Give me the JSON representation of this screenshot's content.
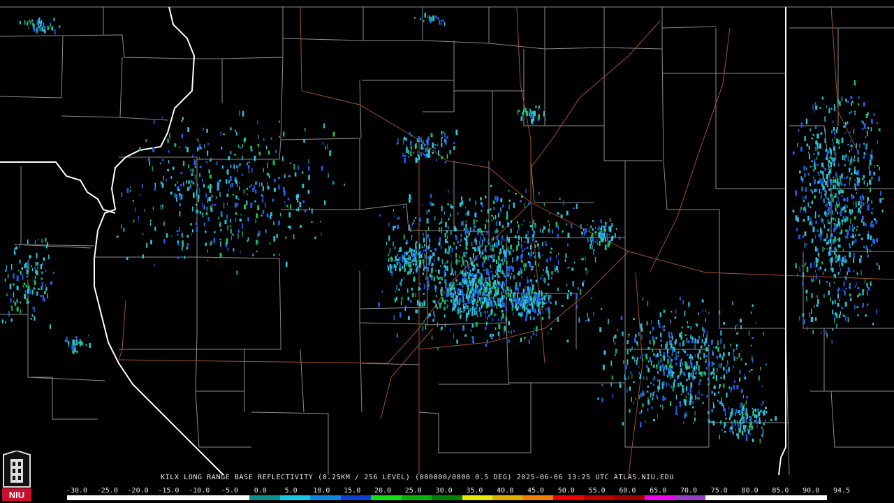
{
  "caption": "KILX LONG RANGE BASE REFLECTIVITY (0.25KM / 256 LEVEL) (000000/0000 0.5 DEG) 2025-06-06 13:25 UTC  ATLAS.NIU.EDU",
  "legend": {
    "ticks": [
      "-30.0",
      "-25.0",
      "-20.0",
      "-15.0",
      "-10.0",
      "-5.0",
      "0.0",
      "5.0",
      "10.0",
      "15.0",
      "20.0",
      "25.0",
      "30.0",
      "35.0",
      "40.0",
      "45.0",
      "50.0",
      "55.0",
      "60.0",
      "65.0",
      "70.0",
      "75.0",
      "80.0",
      "85.0",
      "90.0",
      "94.5"
    ],
    "colors": [
      "#ffffff",
      "#ffffff",
      "#ffffff",
      "#ffffff",
      "#ffffff",
      "#ffffff",
      "#0a8f8f",
      "#10c8e0",
      "#0c86e0",
      "#1040d0",
      "#10e010",
      "#08b008",
      "#048004",
      "#e8e800",
      "#e0b000",
      "#f08000",
      "#f00000",
      "#c00000",
      "#a00000",
      "#f000f0",
      "#9040c0",
      "#ffffff",
      "#ffffff",
      "#ffffff",
      "#ffffff"
    ]
  },
  "logo": {
    "text": "NIU",
    "color": "#c8102e"
  },
  "map_colors": {
    "background": "#000000",
    "county": "#8c8c8c",
    "state": "#ffffff",
    "highway": "#a0522d",
    "echo_light": "#2ec4d6",
    "echo_mid": "#1e60e8",
    "echo_strong": "#18c060"
  }
}
